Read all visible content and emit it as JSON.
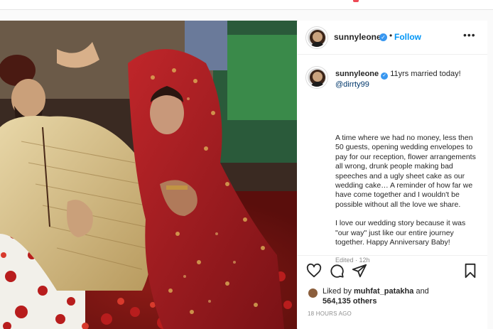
{
  "post": {
    "username": "sunnyleone",
    "follow_label": "Follow",
    "dot": "•",
    "more_label": "•••"
  },
  "caption": {
    "username": "sunnyleone",
    "first_line": "11yrs married today!",
    "mention": "@dirrty99",
    "paragraph1": "A time where we had no money, less then 50 guests, opening wedding envelopes to pay for our reception, flower arrangements all wrong, drunk people making bad speeches and a ugly sheet cake as our wedding cake… A reminder of how far we have come together and I wouldn't be possible without all the love we share.",
    "paragraph2": "I love our wedding story because it was \"our way\" just like our entire journey together. Happy Anniversary Baby!",
    "edited": "Edited · 12h"
  },
  "likes": {
    "prefix": "Liked by ",
    "user": "muhfat_patakha",
    "and": " and",
    "count": "564,135 others"
  },
  "timestamp": "18 HOURS AGO",
  "icons": {
    "verified": "verified-badge-icon",
    "like": "heart-icon",
    "comment": "comment-icon",
    "share": "share-icon",
    "save": "bookmark-icon"
  },
  "colors": {
    "accent": "#0095f6",
    "verified": "#3897f0",
    "text": "#262626",
    "muted": "#8e8e8e"
  }
}
